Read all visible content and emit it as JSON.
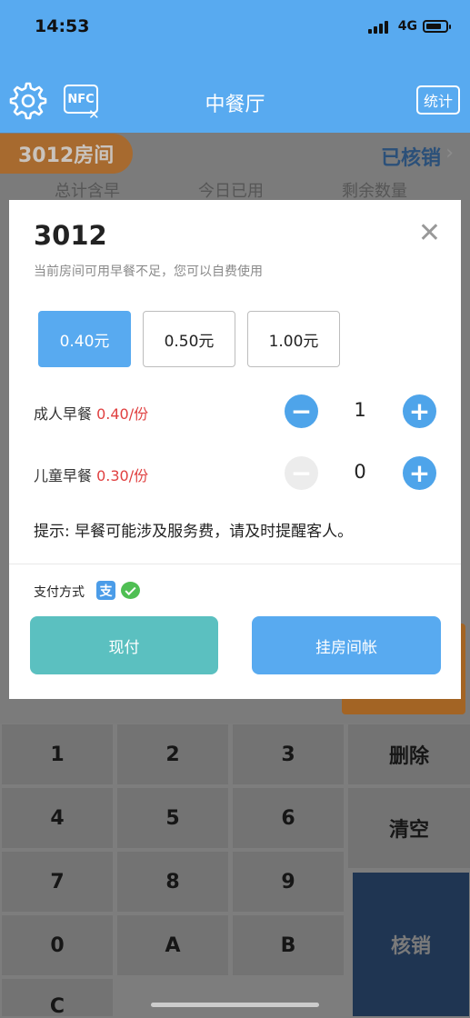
{
  "status": {
    "time": "14:53",
    "network": "4G"
  },
  "nav": {
    "title": "中餐厅",
    "nfc_label": "NFC",
    "nfc_x": "✕",
    "stats_label": "统计"
  },
  "room": {
    "pill": "3012房间",
    "verified": "已核销",
    "chevron": "›"
  },
  "columns": [
    "总计含早",
    "今日已用",
    "剩余数量"
  ],
  "dialog": {
    "room_number": "3012",
    "close": "✕",
    "note": "当前房间可用早餐不足，您可以自费使用",
    "prices": [
      "0.40元",
      "0.50元",
      "1.00元"
    ],
    "selected_price": "0.40元",
    "adult": {
      "label": "成人早餐",
      "price": "0.40/份",
      "qty": "1"
    },
    "child": {
      "label": "儿童早餐",
      "price": "0.30/份",
      "qty": "0"
    },
    "tip": "提示: 早餐可能涉及服务费，请及时提醒客人。",
    "payment_label": "支付方式",
    "cash_button": "现付",
    "charge_room_button": "挂房间帐",
    "colors": {
      "cash": "#5bc0c0",
      "charge": "#58aaf0",
      "primary": "#58aaf0",
      "price_red": "#e04040"
    }
  },
  "keypad": {
    "digits": [
      "1",
      "2",
      "3",
      "4",
      "5",
      "6",
      "7",
      "8",
      "9",
      "0",
      "A",
      "B",
      "C"
    ],
    "delete": "删除",
    "clear": "清空",
    "confirm": "核销"
  }
}
